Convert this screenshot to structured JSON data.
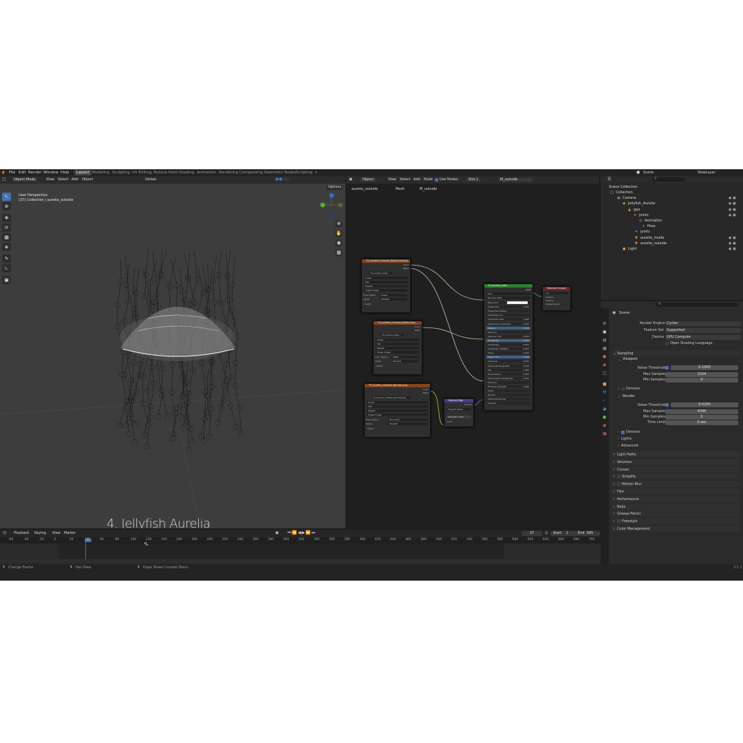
{
  "menu": [
    "File",
    "Edit",
    "Render",
    "Window",
    "Help"
  ],
  "workspaces": [
    "Layout",
    "Modeling",
    "Sculpting",
    "UV Editing",
    "Texture Paint",
    "Shading",
    "Animation",
    "Rendering",
    "Compositing",
    "Geometry Nodes",
    "Scripting"
  ],
  "workspace_add": "+",
  "scene_name": "Scene",
  "view_layer": "ViewLayer",
  "viewport": {
    "mode": "Object Mode",
    "menus": [
      "View",
      "Select",
      "Add",
      "Object"
    ],
    "transform": "Global",
    "options": "Options",
    "perspective": "User Perspective",
    "collection": "(37) Collection | aurelia_outside",
    "caption": "4. Jellyfish Aurelia"
  },
  "node_editor": {
    "type": "Object",
    "menus": [
      "View",
      "Select",
      "Add",
      "Node"
    ],
    "use_nodes": "Use Nodes",
    "slot": "Slot 1",
    "material": "M_outside",
    "breadcrumb": [
      "aurelia_outside",
      "Mesh",
      "M_outside"
    ],
    "tex1": {
      "title": "TX_Aurelia_Outside_BaseColor.png",
      "image": "TX_Aurelia_Outsi...",
      "out": [
        "Color",
        "Alpha"
      ],
      "opts": [
        "Linear",
        "Flat",
        "Repeat",
        "Single Image"
      ],
      "cs_label": "Color Space",
      "cs": "Linear",
      "alpha_label": "Alpha",
      "alpha": "Straight",
      "vector": "Vector"
    },
    "tex2": {
      "title": "TX_Aurelia_Outside_Matter.png",
      "image": "TX_Aurelia_Outsi...",
      "out": [
        "Color",
        "Alpha"
      ],
      "opts": [
        "Linear",
        "Flat",
        "Repeat",
        "Single Image"
      ],
      "cs_label": "Color Space",
      "cs": "sRGB",
      "alpha_label": "Alpha",
      "alpha": "Straight",
      "vector": "Vector"
    },
    "tex3": {
      "title": "TX_Aurelia_Outside_Normal.png",
      "image": "TX_Aurelia_Outside_Normal.png",
      "out": [
        "Color",
        "Alpha"
      ],
      "opts": [
        "Linear",
        "Flat",
        "Repeat",
        "Single Image"
      ],
      "cs_label": "Color Space",
      "cs": "Non-Color",
      "alpha_label": "Alpha",
      "alpha": "Straight",
      "vector": "Vector"
    },
    "normal_map": {
      "title": "Normal Map",
      "out": "Normal",
      "space": "Tangent Space",
      "strength_label": "Strength",
      "strength": "1.000",
      "color": "Color"
    },
    "bsdf": {
      "title": "M_aurelia_outer",
      "out": "BSDF",
      "dist": "GGX",
      "ss": "Random Walk",
      "rows": [
        [
          "Base Color",
          ""
        ],
        [
          "Subsurface",
          "0.000"
        ],
        [
          "Subsurface Radius",
          ""
        ],
        [
          "Subsurface Co...",
          ""
        ],
        [
          "Subsurface IOR",
          "1.400"
        ],
        [
          "Subsurface Anisotropy",
          "0.000"
        ],
        [
          "Metallic",
          "0.000"
        ],
        [
          "Specular",
          ""
        ],
        [
          "Specular Tint",
          "0.000"
        ],
        [
          "Roughness",
          "0.500"
        ],
        [
          "Anisotropic",
          "0.000"
        ],
        [
          "Anisotropic Rotation",
          "0.000"
        ],
        [
          "Sheen",
          "0.000"
        ],
        [
          "Sheen Tint",
          "0.500"
        ],
        [
          "Clearcoat",
          "0.000"
        ],
        [
          "Clearcoat Roughness",
          "0.030"
        ],
        [
          "IOR",
          "1.450"
        ],
        [
          "Transmission",
          "0.000"
        ],
        [
          "Transmission Roughness",
          "0.000"
        ],
        [
          "Emission",
          ""
        ],
        [
          "Emission Strength",
          "1.000"
        ],
        [
          "Alpha",
          ""
        ],
        [
          "Normal",
          ""
        ],
        [
          "Clearcoat Normal",
          ""
        ],
        [
          "Tangent",
          ""
        ]
      ]
    },
    "output": {
      "title": "Material Output",
      "target": "All",
      "rows": [
        "Surface",
        "Volume",
        "Displacement"
      ]
    }
  },
  "outliner": {
    "root": "Scene Collection",
    "items": [
      "Collection",
      "Camera",
      "Jellyfish_Aurelia",
      "geo",
      "joints",
      "Animation",
      "Pose",
      "joints",
      "aurelia_inside",
      "aurelia_outside",
      "Light"
    ]
  },
  "properties": {
    "scene": "Scene",
    "render_engine_label": "Render Engine",
    "render_engine": "Cycles",
    "feature_set_label": "Feature Set",
    "feature_set": "Supported",
    "device_label": "Device",
    "device": "GPU Compute",
    "osl": "Open Shading Language",
    "sampling": "Sampling",
    "viewport": "Viewport",
    "noise_threshold": "Noise Threshold",
    "vp_noise": "0.1000",
    "max_samples": "Max Samples",
    "vp_max": "1024",
    "min_samples": "Min Samples",
    "vp_min": "0",
    "denoise": "Denoise",
    "render": "Render",
    "r_noise": "0.0100",
    "r_max": "4096",
    "r_min": "0",
    "time_limit": "Time Limit",
    "r_time": "0 sec",
    "lights": "Lights",
    "advanced": "Advanced",
    "panels": [
      "Light Paths",
      "Volumes",
      "Curves",
      "Simplify",
      "Motion Blur",
      "Film",
      "Performance",
      "Bake",
      "Grease Pencil",
      "Freestyle",
      "Color Management"
    ]
  },
  "timeline": {
    "menus": [
      "Playback",
      "Keying",
      "View",
      "Marker"
    ],
    "current": "37",
    "start_label": "Start",
    "start": "1",
    "end_label": "End",
    "end": "585",
    "ticks": [
      "-60",
      "-40",
      "-20",
      "0",
      "20",
      "37",
      "60",
      "80",
      "100",
      "120",
      "140",
      "160",
      "180",
      "200",
      "220",
      "240",
      "260",
      "280",
      "300",
      "320",
      "340",
      "360",
      "380",
      "400",
      "420",
      "440",
      "460",
      "480",
      "500",
      "520",
      "540",
      "560",
      "580",
      "600",
      "620",
      "640",
      "660",
      "680",
      "700"
    ]
  },
  "status": {
    "left": "Change Frame",
    "mid": "Pan View",
    "right": "Dope Sheet Context Menu",
    "version": "3.5.1"
  },
  "colors": {
    "accent": "#4772b3",
    "tex_header": "#83451b",
    "bsdf_header": "#2e7d32",
    "out_header": "#7b1f2b",
    "vec_header": "#4a3b8f"
  }
}
